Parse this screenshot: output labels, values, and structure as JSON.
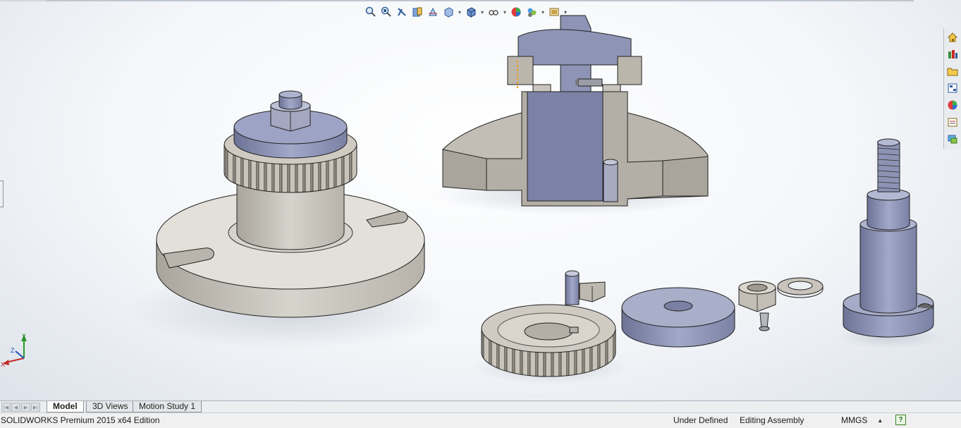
{
  "heads_up_toolbar": {
    "icons": [
      "zoom-to-fit-icon",
      "zoom-to-area-icon",
      "previous-view-icon",
      "section-view-icon",
      "dynamic-annotation-icon",
      "view-orientation-icon",
      "display-style-icon",
      "hide-show-items-icon",
      "edit-appearance-icon",
      "apply-scene-icon",
      "view-settings-icon"
    ]
  },
  "task_pane": {
    "icons": [
      "solidworks-resources-icon",
      "design-library-icon",
      "file-explorer-icon",
      "view-palette-icon",
      "appearances-scenes-icon",
      "custom-properties-icon",
      "solidworks-forum-icon"
    ]
  },
  "triad": {
    "x_label": "X",
    "y_label": "Y",
    "z_label": "Z"
  },
  "tabs": [
    {
      "label": "Model",
      "active": true
    },
    {
      "label": "3D Views",
      "active": false
    },
    {
      "label": "Motion Study 1",
      "active": false
    }
  ],
  "status": {
    "product": "SOLIDWORKS Premium 2015 x64 Edition",
    "definition": "Under Defined",
    "mode": "Editing Assembly",
    "units": "MMGS",
    "units_caret": "▴",
    "help": "?"
  },
  "colors": {
    "part_gray": "#c8c4bc",
    "part_blue": "#8a90b3",
    "accent_orange": "#f59a23"
  }
}
